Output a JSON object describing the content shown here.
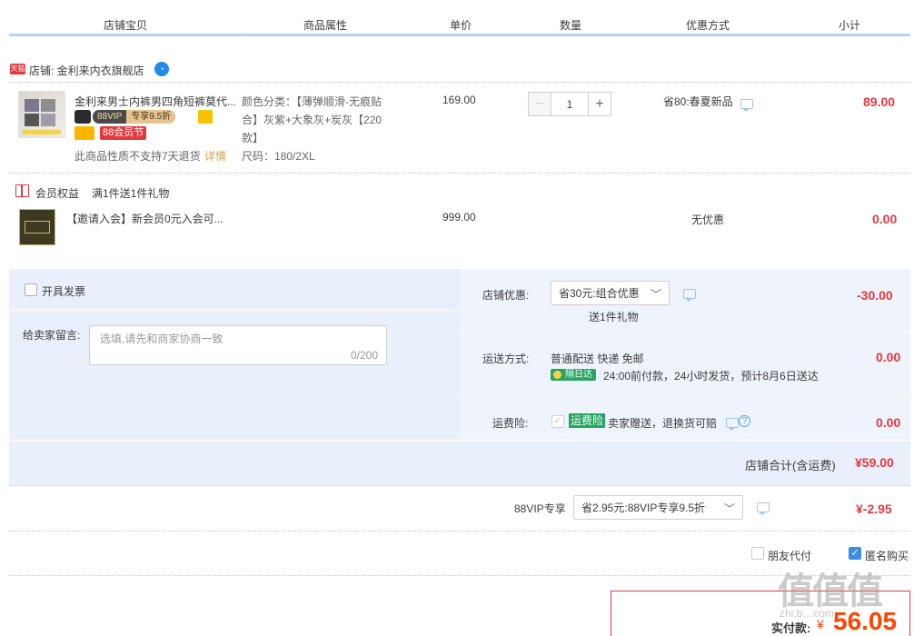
{
  "header": {
    "columns": [
      "店铺宝贝",
      "商品属性",
      "单价",
      "数量",
      "优惠方式",
      "小计"
    ]
  },
  "shop": {
    "badge": "天猫",
    "name": "店铺: 金利来内衣旗舰店",
    "chat_icon": "wangwang-chat-icon"
  },
  "item": {
    "title": "金利来男士内裤男四角短裤莫代...",
    "vip_tag": "88VIP",
    "vip_discount": "专享9.5折",
    "promo_tag": "88会员节",
    "no_return_note": "此商品性质不支持7天退货",
    "detail_link": "详情",
    "attr_color": "颜色分类：【薄弹顺滑-无痕贴合】灰紫+大象灰+炭灰【220款】",
    "attr_size": "尺码：180/2XL",
    "unit_price": "169.00",
    "quantity": "1",
    "discount": "省80:春夏新品",
    "subtotal": "89.00"
  },
  "member": {
    "label": "会员权益",
    "gift": "满1件送1件礼物",
    "item_title": "【邀请入会】新会员0元入会可...",
    "unit_price": "999.00",
    "discount": "无优惠",
    "subtotal": "0.00"
  },
  "invoice": {
    "label": "开具发票"
  },
  "message": {
    "label": "给卖家留言:",
    "placeholder": "选填,请先和商家协商一致",
    "counter": "0/200"
  },
  "shop_discount": {
    "label": "店铺优惠:",
    "selected": "省30元:组合优惠",
    "note": "送1件礼物",
    "amount": "-30.00"
  },
  "shipping": {
    "label": "运送方式:",
    "method": "普通配送 快递 免邮",
    "badge": "隔日达",
    "eta": "24:00前付款，24小时发货，预计8月6日送达",
    "amount": "0.00"
  },
  "insurance": {
    "label": "运费险:",
    "badge": "运费险",
    "text": "卖家赠送，退换货可赔",
    "amount": "0.00"
  },
  "shop_total": {
    "label": "店铺合计(含运费)",
    "amount": "¥59.00"
  },
  "vip": {
    "label": "88VIP专享",
    "selected": "省2.95元:88VIP专享9.5折",
    "amount": "¥-2.95"
  },
  "options": {
    "friend_pay": "朋友代付",
    "anonymous": "匿名购买"
  },
  "pay": {
    "label": "实付款:",
    "currency": "¥",
    "amount": "56.05"
  },
  "watermark": {
    "text": "值值值",
    "sub": "zhi.b…com"
  },
  "colors": {
    "accent": "#f40",
    "header_line": "#b2d1ff",
    "panel_bg": "#e9f0fb",
    "pay_border": "#e4393c"
  }
}
